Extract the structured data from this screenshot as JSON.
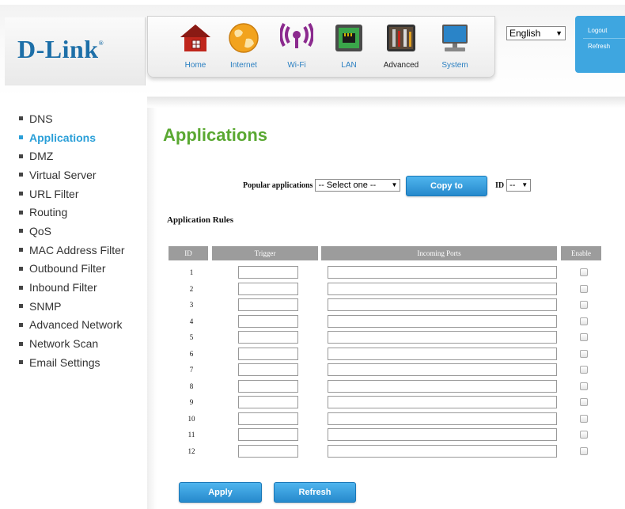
{
  "header": {
    "logo": "D-Link",
    "logo_mark": "®",
    "nav": [
      {
        "label": "Home"
      },
      {
        "label": "Internet"
      },
      {
        "label": "Wi-Fi"
      },
      {
        "label": "LAN"
      },
      {
        "label": "Advanced"
      },
      {
        "label": "System"
      }
    ],
    "language": "English",
    "logout": "Logout",
    "refresh": "Refresh"
  },
  "menu": [
    {
      "label": "DNS"
    },
    {
      "label": "Applications"
    },
    {
      "label": "DMZ"
    },
    {
      "label": "Virtual Server"
    },
    {
      "label": "URL Filter"
    },
    {
      "label": "Routing"
    },
    {
      "label": "QoS"
    },
    {
      "label": "MAC Address Filter"
    },
    {
      "label": "Outbound Filter"
    },
    {
      "label": "Inbound Filter"
    },
    {
      "label": "SNMP"
    },
    {
      "label": "Advanced Network"
    },
    {
      "label": "Network Scan"
    },
    {
      "label": "Email Settings"
    }
  ],
  "page": {
    "title": "Applications",
    "popular_label": "Popular applications",
    "popular_value": "-- Select one --",
    "copy_to": "Copy to",
    "id_label": "ID",
    "id_value": "--",
    "rules_title": "Application Rules",
    "columns": {
      "id": "ID",
      "trigger": "Trigger",
      "incoming": "Incoming Ports",
      "enable": "Enable"
    },
    "rows": [
      {
        "id": "1",
        "trigger": "",
        "ports": "",
        "enabled": false
      },
      {
        "id": "2",
        "trigger": "",
        "ports": "",
        "enabled": false
      },
      {
        "id": "3",
        "trigger": "",
        "ports": "",
        "enabled": false
      },
      {
        "id": "4",
        "trigger": "",
        "ports": "",
        "enabled": false
      },
      {
        "id": "5",
        "trigger": "",
        "ports": "",
        "enabled": false
      },
      {
        "id": "6",
        "trigger": "",
        "ports": "",
        "enabled": false
      },
      {
        "id": "7",
        "trigger": "",
        "ports": "",
        "enabled": false
      },
      {
        "id": "8",
        "trigger": "",
        "ports": "",
        "enabled": false
      },
      {
        "id": "9",
        "trigger": "",
        "ports": "",
        "enabled": false
      },
      {
        "id": "10",
        "trigger": "",
        "ports": "",
        "enabled": false
      },
      {
        "id": "11",
        "trigger": "",
        "ports": "",
        "enabled": false
      },
      {
        "id": "12",
        "trigger": "",
        "ports": "",
        "enabled": false
      }
    ],
    "apply": "Apply",
    "refresh": "Refresh"
  },
  "colors": {
    "accent": "#2a9fd8",
    "title_green": "#5aa832",
    "button_blue": "#2e93d6"
  }
}
